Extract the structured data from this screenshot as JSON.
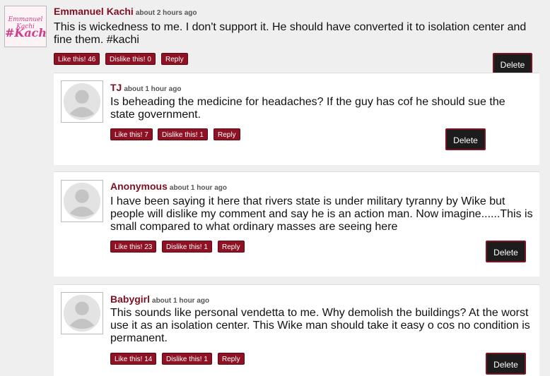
{
  "main_comment": {
    "author": "Emmanuel Kachi",
    "time": "about 2 hours ago",
    "text": "This is wickedness to me. I don't support it. He should have converted it to isolation center and fine them. #kachi",
    "avatar_text_top": "Emmanuel Kachi",
    "avatar_text_main": "#Kachi",
    "like_label": "Like this! 46",
    "dislike_label": "Dislike this! 0",
    "reply_label": "Reply",
    "delete_label": "Delete"
  },
  "replies": [
    {
      "author": "TJ",
      "time": "about 1 hour ago",
      "text": "Is beheading the medicine for headaches? If the guy has cof he should sue the state government.",
      "like_label": "Like this! 7",
      "dislike_label": "Dislike this! 1",
      "reply_label": "Reply",
      "delete_label": "Delete"
    },
    {
      "author": "Anonymous",
      "time": "about 1 hour ago",
      "text": "I have been saying it here that rivers state is under military tyranny by Wike but people will dislike my comment and say he is an action man. Now imagine......This is small compared to what ordinary masses are seeing here",
      "like_label": "Like this! 23",
      "dislike_label": "Dislike this! 1",
      "reply_label": "Reply",
      "delete_label": "Delete"
    },
    {
      "author": "Babygirl",
      "time": "about 1 hour ago",
      "text": "This sounds like personal vendetta to me. Why demolish the buildings? At the worst use it as an isolation center. This Wike man should take it easy o cos no condition is permanent.",
      "like_label": "Like this! 14",
      "dislike_label": "Dislike this! 1",
      "reply_label": "Reply",
      "delete_label": "Delete"
    }
  ],
  "colors": {
    "accent": "#8e1224",
    "author": "#7e1022",
    "delete_bg": "#1c1c1c"
  }
}
